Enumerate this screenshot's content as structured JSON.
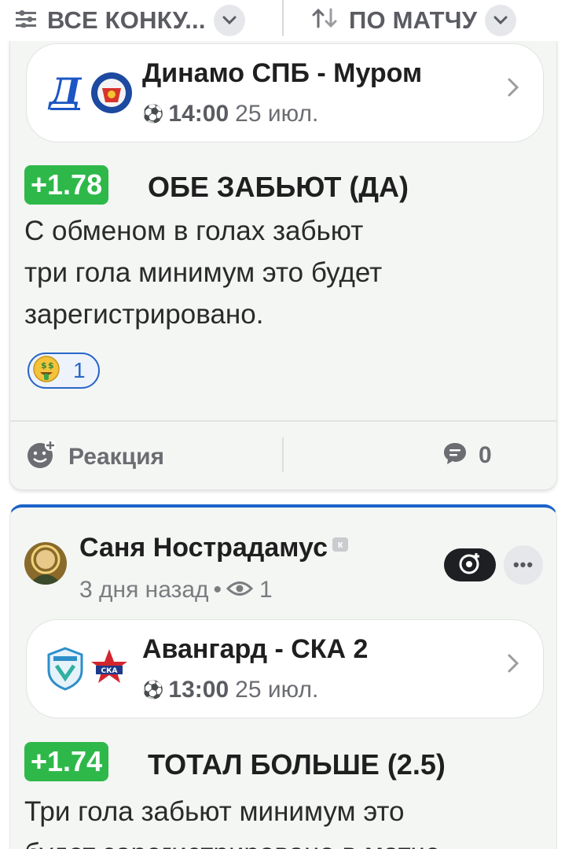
{
  "filters": {
    "competitions_label": "ВСЕ КОНКУ...",
    "sort_label": "ПО МАТЧУ"
  },
  "posts": [
    {
      "match": {
        "title": "Динамо СПБ - Муром",
        "time": "14:00",
        "date": "25 июл."
      },
      "odds": "+1.78",
      "bet_type": "ОБЕ ЗАБЬЮТ (ДА)",
      "comment": "С обменом в голах забьют\nтри гола минимум это будет\nзарегистрировано.",
      "reaction_count": "1",
      "actions": {
        "react_label": "Реакция",
        "comments_count": "0"
      }
    },
    {
      "author": {
        "name": "Саня Нострадамус",
        "time_ago": "3 дня назад",
        "views": "1"
      },
      "match": {
        "title": "Авангард - СКА 2",
        "time": "13:00",
        "date": "25 июл."
      },
      "odds": "+1.74",
      "bet_type": "ТОТАЛ БОЛЬШЕ (2.5)",
      "comment": "Три гола забьют минимум это\nбудет зарегистрировано в матче"
    }
  ],
  "colors": {
    "odds_green": "#2fb84a",
    "accent_blue": "#1c63c9",
    "chip_border": "#2a66c9"
  }
}
